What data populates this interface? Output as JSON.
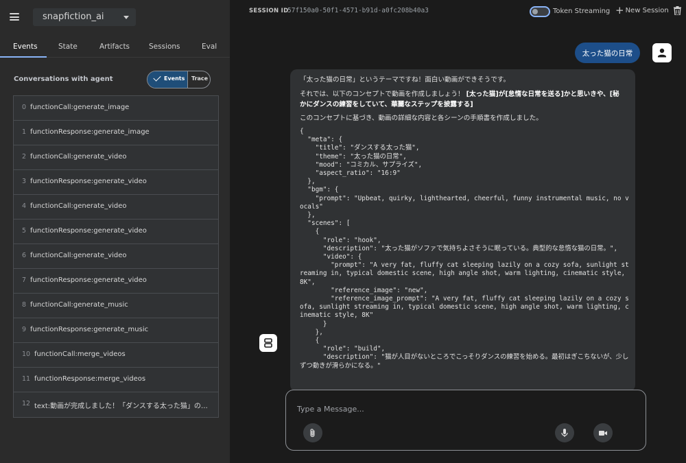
{
  "sidebar": {
    "app_name": "snapfiction_ai",
    "tabs": [
      {
        "label": "Events"
      },
      {
        "label": "State"
      },
      {
        "label": "Artifacts"
      },
      {
        "label": "Sessions"
      },
      {
        "label": "Eval"
      }
    ],
    "conversations_title": "Conversations with agent",
    "toggle": {
      "events_label": "Events",
      "trace_label": "Trace"
    },
    "events": [
      {
        "index": "0",
        "text": "functionCall:generate_image"
      },
      {
        "index": "1",
        "text": "functionResponse:generate_image"
      },
      {
        "index": "2",
        "text": "functionCall:generate_video"
      },
      {
        "index": "3",
        "text": "functionResponse:generate_video"
      },
      {
        "index": "4",
        "text": "functionCall:generate_video"
      },
      {
        "index": "5",
        "text": "functionResponse:generate_video"
      },
      {
        "index": "6",
        "text": "functionCall:generate_video"
      },
      {
        "index": "7",
        "text": "functionResponse:generate_video"
      },
      {
        "index": "8",
        "text": "functionCall:generate_music"
      },
      {
        "index": "9",
        "text": "functionResponse:generate_music"
      },
      {
        "index": "10",
        "text": "functionCall:merge_videos"
      },
      {
        "index": "11",
        "text": "functionResponse:merge_videos"
      },
      {
        "index": "12",
        "text": "text:動画が完成しました！「ダンスする太った猫」の動..."
      }
    ]
  },
  "header": {
    "session_label": "SESSION ID",
    "session_id": "57f150a0-50f1-4571-b91d-a0fc208b40a3",
    "token_streaming_label": "Token Streaming",
    "new_session_label": "New Session"
  },
  "chat": {
    "user_message": "太った猫の日常",
    "bot": {
      "line1": "「太った猫の日常」というテーマですね！面白い動画ができそうです。",
      "line2_prefix": "それでは、以下のコンセプトで動画を作成しましょう！",
      "line2_bold_a": "[太った猫]が[怠惰な日常を送る]かと思いきや、[秘",
      "line2_bold_b": "かにダンスの練習をしていて、華麗なステップを披露する]",
      "line3": "このコンセプトに基づき、動画の詳細な内容と各シーンの手順書を作成しました。",
      "code": "{\n  \"meta\": {\n    \"title\": \"ダンスする太った猫\",\n    \"theme\": \"太った猫の日常\",\n    \"mood\": \"コミカル、サプライズ\",\n    \"aspect_ratio\": \"16:9\"\n  },\n  \"bgm\": {\n    \"prompt\": \"Upbeat, quirky, lighthearted, cheerful, funny instrumental music, no vocals\"\n  },\n  \"scenes\": [\n    {\n      \"role\": \"hook\",\n      \"description\": \"太った猫がソファで気持ちよさそうに眠っている。典型的な怠惰な猫の日常。\",\n      \"video\": {\n        \"prompt\": \"A very fat, fluffy cat sleeping lazily on a cozy sofa, sunlight streaming in, typical domestic scene, high angle shot, warm lighting, cinematic style, 8K\",\n        \"reference_image\": \"new\",\n        \"reference_image_prompt\": \"A very fat, fluffy cat sleeping lazily on a cozy sofa, sunlight streaming in, typical domestic scene, high angle shot, warm lighting, cinematic style, 8K\"\n      }\n    },\n    {\n      \"role\": \"build\",\n      \"description\": \"猫が人目がないところでこっそりダンスの練習を始める。最初はぎこちないが、少しずつ動きが滑らかになる。\""
    }
  },
  "composer": {
    "placeholder": "Type a Message..."
  },
  "icons": {
    "menu": "menu-icon",
    "dropdown": "chevron-down-icon",
    "check": "check-icon",
    "add": "plus-icon",
    "delete": "trash-icon",
    "user": "person-icon",
    "bot": "robot-icon",
    "attach": "paperclip-icon",
    "mic": "microphone-icon",
    "camera": "videocam-icon"
  },
  "colors": {
    "accent": "#8ab4f8",
    "user_bubble": "#1d4e89",
    "toggle_active": "#1f4e79"
  }
}
